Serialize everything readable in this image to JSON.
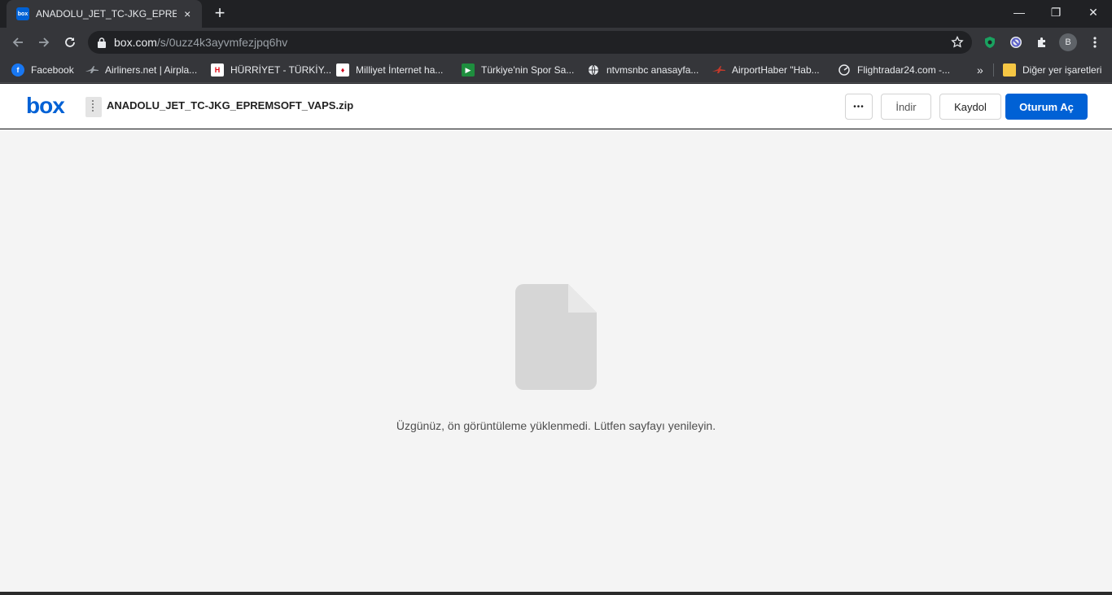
{
  "tab": {
    "title": "ANADOLU_JET_TC-JKG_EPREMSOFT_VAPS.zip",
    "favicon": "box",
    "close": "×"
  },
  "new_tab": "+",
  "window": {
    "minimize": "—",
    "restore": "❐",
    "close": "✕"
  },
  "omnibox": {
    "host": "box.com",
    "path": "/s/0uzz4k3ayvmfezjpq6hv"
  },
  "profile": {
    "initial": "B"
  },
  "bookmarks": {
    "items": [
      {
        "label": "Facebook",
        "icon": "facebook-icon",
        "color": "#1877f2"
      },
      {
        "label": "Airliners.net | Airpla...",
        "icon": "airliners-icon",
        "color": "#444444"
      },
      {
        "label": "HÜRRİYET - TÜRKİY...",
        "icon": "hurriyet-icon",
        "color": "#e30613"
      },
      {
        "label": "Milliyet İnternet ha...",
        "icon": "milliyet-icon",
        "color": "#d0021b"
      },
      {
        "label": "Türkiye'nin Spor Sa...",
        "icon": "spor-icon",
        "color": "#1e8e3e"
      },
      {
        "label": "ntvmsnbc anasayfa...",
        "icon": "globe-icon",
        "color": "#e8eaed"
      },
      {
        "label": "AirportHaber \"Hab...",
        "icon": "airporthaber-icon",
        "color": "#c0392b"
      },
      {
        "label": "Flightradar24.com -...",
        "icon": "flightradar-icon",
        "color": "#e8eaed"
      }
    ],
    "overflow": "»",
    "other": "Diğer yer işaretleri"
  },
  "header": {
    "logo": "box",
    "file_name": "ANADOLU_JET_TC-JKG_EPREMSOFT_VAPS.zip",
    "more_label": "•••",
    "download_label": "İndir",
    "signup_label": "Kaydol",
    "login_label": "Oturum Aç"
  },
  "preview": {
    "message": "Üzgünüz, ön görüntüleme yüklenmedi. Lütfen sayfayı yenileyin."
  },
  "colors": {
    "accent": "#0061d5",
    "content_bg": "#f4f4f4"
  }
}
